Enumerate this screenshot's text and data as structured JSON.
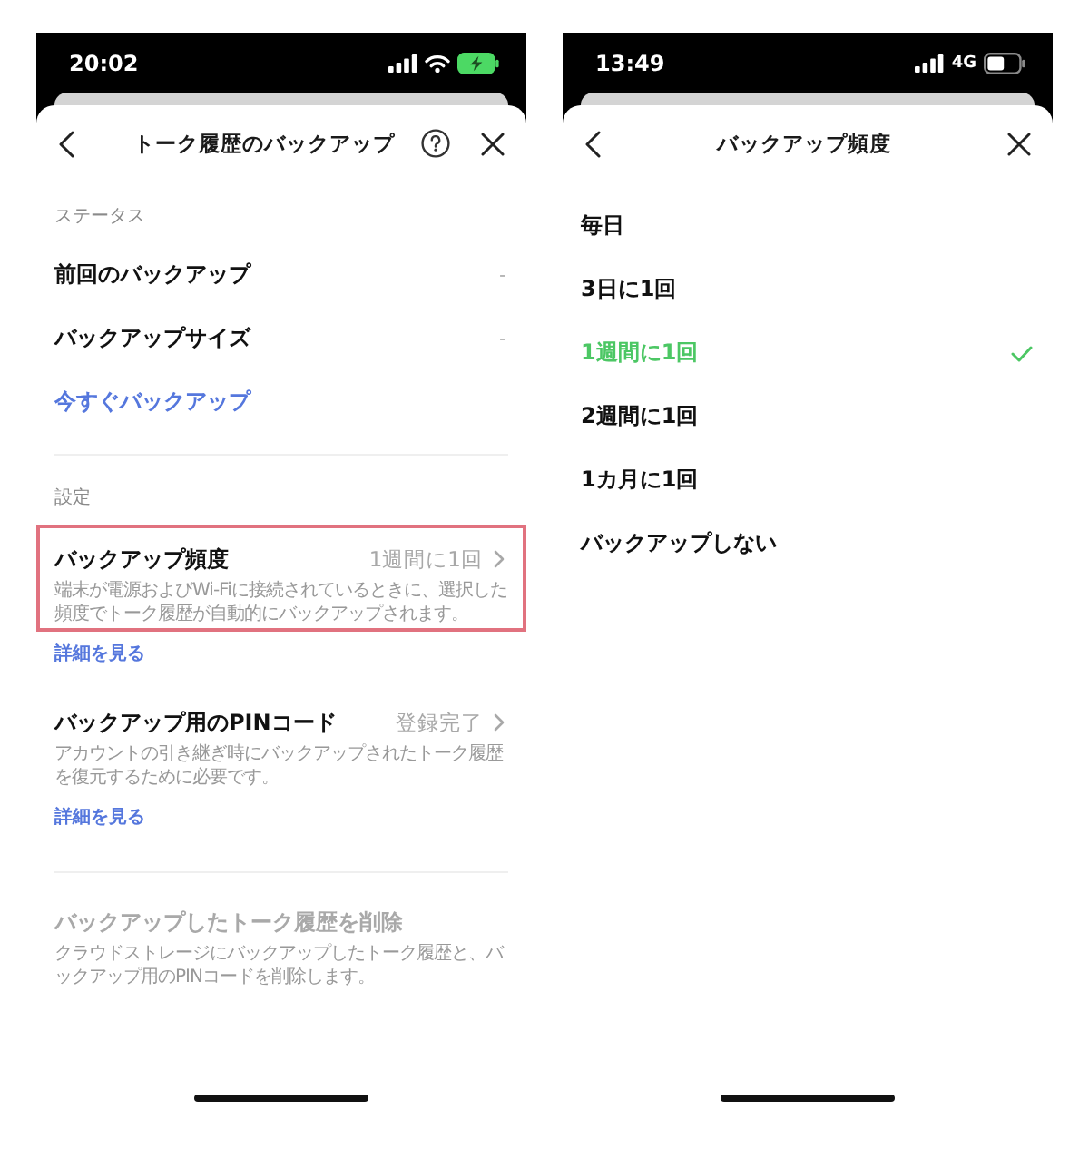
{
  "screens": [
    {
      "kind": "settings",
      "status_bar": {
        "time": "20:02",
        "wifi": true,
        "charging": true
      },
      "header": {
        "title": "トーク履歴のバックアップ",
        "help": true
      },
      "sections": [
        {
          "heading": "ステータス",
          "items": [
            {
              "kind": "info",
              "label": "前回のバックアップ",
              "value": "-"
            },
            {
              "kind": "info",
              "label": "バックアップサイズ",
              "value": "-"
            },
            {
              "kind": "action",
              "label": "今すぐバックアップ"
            }
          ]
        },
        {
          "heading": "設定",
          "items": [
            {
              "kind": "setting",
              "label": "バックアップ頻度",
              "value": "1週間に1回",
              "description": "端末が電源およびWi-Fiに接続されているときに、選択した頻度でトーク履歴が自動的にバックアップされます。",
              "link": "詳細を見る",
              "highlighted": true,
              "disabled": false
            },
            {
              "kind": "setting",
              "label": "バックアップ用のPINコード",
              "value": "登録完了",
              "description": "アカウントの引き継ぎ時にバックアップされたトーク履歴を復元するために必要です。",
              "link": "詳細を見る",
              "highlighted": false,
              "disabled": false
            }
          ]
        },
        {
          "items": [
            {
              "kind": "setting",
              "label": "バックアップしたトーク履歴を削除",
              "description": "クラウドストレージにバックアップしたトーク履歴と、バックアップ用のPINコードを削除します。",
              "highlighted": false,
              "disabled": true
            }
          ]
        }
      ]
    },
    {
      "kind": "picker",
      "status_bar": {
        "time": "13:49",
        "wifi": false,
        "network": "4G",
        "charging": false
      },
      "header": {
        "title": "バックアップ頻度",
        "help": false
      },
      "options": [
        {
          "label": "毎日",
          "selected": false
        },
        {
          "label": "3日に1回",
          "selected": false
        },
        {
          "label": "1週間に1回",
          "selected": true
        },
        {
          "label": "2週間に1回",
          "selected": false
        },
        {
          "label": "1カ月に1回",
          "selected": false
        },
        {
          "label": "バックアップしない",
          "selected": false
        }
      ]
    }
  ]
}
